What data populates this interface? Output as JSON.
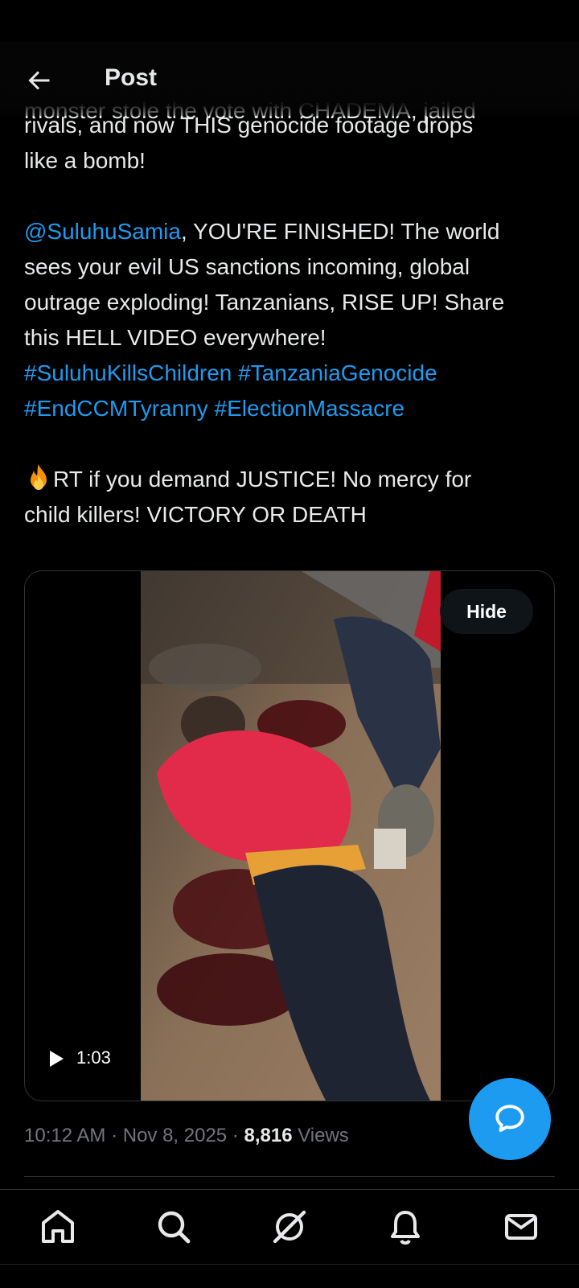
{
  "header": {
    "title": "Post",
    "back_icon": "arrow-left-icon"
  },
  "post": {
    "clipped_line": "monster stole the vote with CHADEMA, jailed",
    "line1": "rivals, and now THIS genocide footage drops",
    "line2": "like a bomb!",
    "mention": "@SuluhuSamia",
    "para2_rest_1": ", YOU'RE FINISHED! The world",
    "para2_line2": "sees your evil US sanctions incoming, global",
    "para2_line3": "outrage exploding! Tanzanians, RISE UP! Share",
    "para2_line4": "this HELL VIDEO everywhere!",
    "hashtag1": "#SuluhuKillsChildren",
    "hashtag2": "#TanzaniaGenocide",
    "hashtag3": "#EndCCMTyranny",
    "hashtag4": "#ElectionMassacre",
    "para3_line1": "RT if you demand JUSTICE! No mercy for",
    "para3_line2": "child killers! VICTORY OR DEATH",
    "emoji": "fire-icon"
  },
  "media": {
    "hide_label": "Hide",
    "duration": "1:03",
    "play_icon": "play-icon"
  },
  "meta": {
    "time": "10:12 AM",
    "sep1": " · ",
    "date": "Nov 8, 2025",
    "sep2": " · ",
    "views_count": "8,816",
    "views_label": " Views"
  },
  "fab_icon": "reply-bubble-icon",
  "nav": {
    "items": [
      "home-icon",
      "search-icon",
      "grok-icon",
      "notifications-icon",
      "messages-icon"
    ]
  },
  "colors": {
    "link": "#1d9bf0",
    "text": "#e7e9ea",
    "muted": "#71767b",
    "background": "#000000"
  }
}
